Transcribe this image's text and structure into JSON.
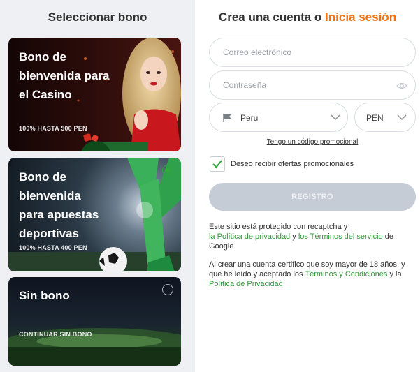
{
  "left": {
    "title": "Seleccionar bono",
    "cards": [
      {
        "title": "Bono de bienvenida para el Casino",
        "subtitle": "100% HASTA 500 PEN",
        "selected": false
      },
      {
        "title": "Bono de bienvenida para apuestas deportivas",
        "subtitle": "100% HASTA 400 PEN",
        "selected": true
      },
      {
        "title": "Sin bono",
        "subtitle": "CONTINUAR SIN BONO",
        "selected": false
      }
    ]
  },
  "right": {
    "title_prefix": "Crea una cuenta o ",
    "login_link": "Inicia sesión",
    "email_placeholder": "Correo electrónico",
    "password_placeholder": "Contraseña",
    "country": "Peru",
    "currency": "PEN",
    "promo_code_link": "Tengo un código promocional",
    "offers_checkbox_label": "Deseo recibir ofertas promocionales",
    "offers_checked": true,
    "register_button": "REGISTRO",
    "recaptcha": {
      "prefix": "Este sitio está protegido con recaptcha y",
      "privacy_link": "la Política de privacidad",
      "and": " y ",
      "terms_link": "los Términos del servicio",
      "suffix": " de Google"
    },
    "age_notice": {
      "text": "Al crear una cuenta certifico que soy mayor de 18 años, y que he leído y aceptado los ",
      "terms_link": "Términos y Condiciones",
      "and": " y la ",
      "privacy_link": "Política de Privacidad"
    }
  },
  "colors": {
    "accent_orange": "#f5720f",
    "accent_green": "#2e9a38",
    "button_disabled": "#c5ccd6"
  }
}
